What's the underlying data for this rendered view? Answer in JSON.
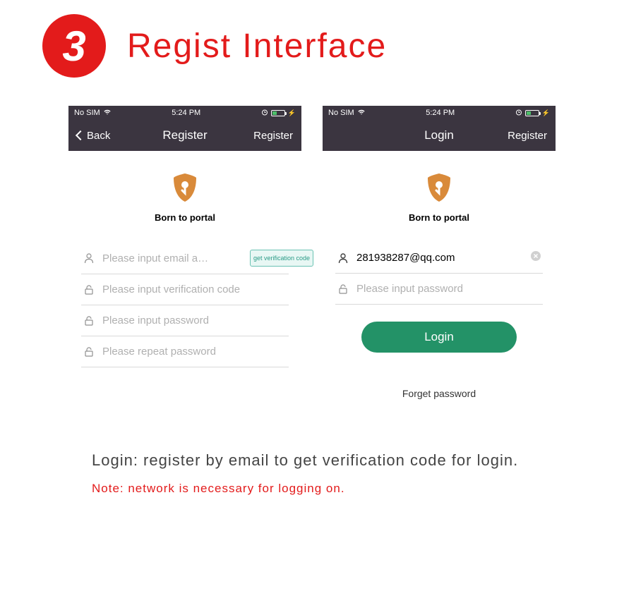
{
  "header": {
    "step_number": "3",
    "title": "Regist Interface"
  },
  "status_bar": {
    "carrier": "No SIM",
    "time": "5:24 PM"
  },
  "phone_register": {
    "nav_back": "Back",
    "nav_title": "Register",
    "nav_right": "Register",
    "logo_text": "Born to portal",
    "email_placeholder": "Please input email a…",
    "verify_button": "get verification code",
    "code_placeholder": "Please input verification code",
    "password_placeholder": "Please input password",
    "repeat_placeholder": "Please repeat password"
  },
  "phone_login": {
    "nav_title": "Login",
    "nav_right": "Register",
    "logo_text": "Born to portal",
    "email_value": "281938287@qq.com",
    "password_placeholder": "Please input password",
    "login_button": "Login",
    "forget_text": "Forget password"
  },
  "footer": {
    "line1": "Login: register by email to get verification code for login.",
    "note": "Note: network is necessary for logging on."
  },
  "colors": {
    "accent_red": "#e31b1b",
    "login_green": "#239267",
    "shield_orange": "#d98a3a"
  }
}
